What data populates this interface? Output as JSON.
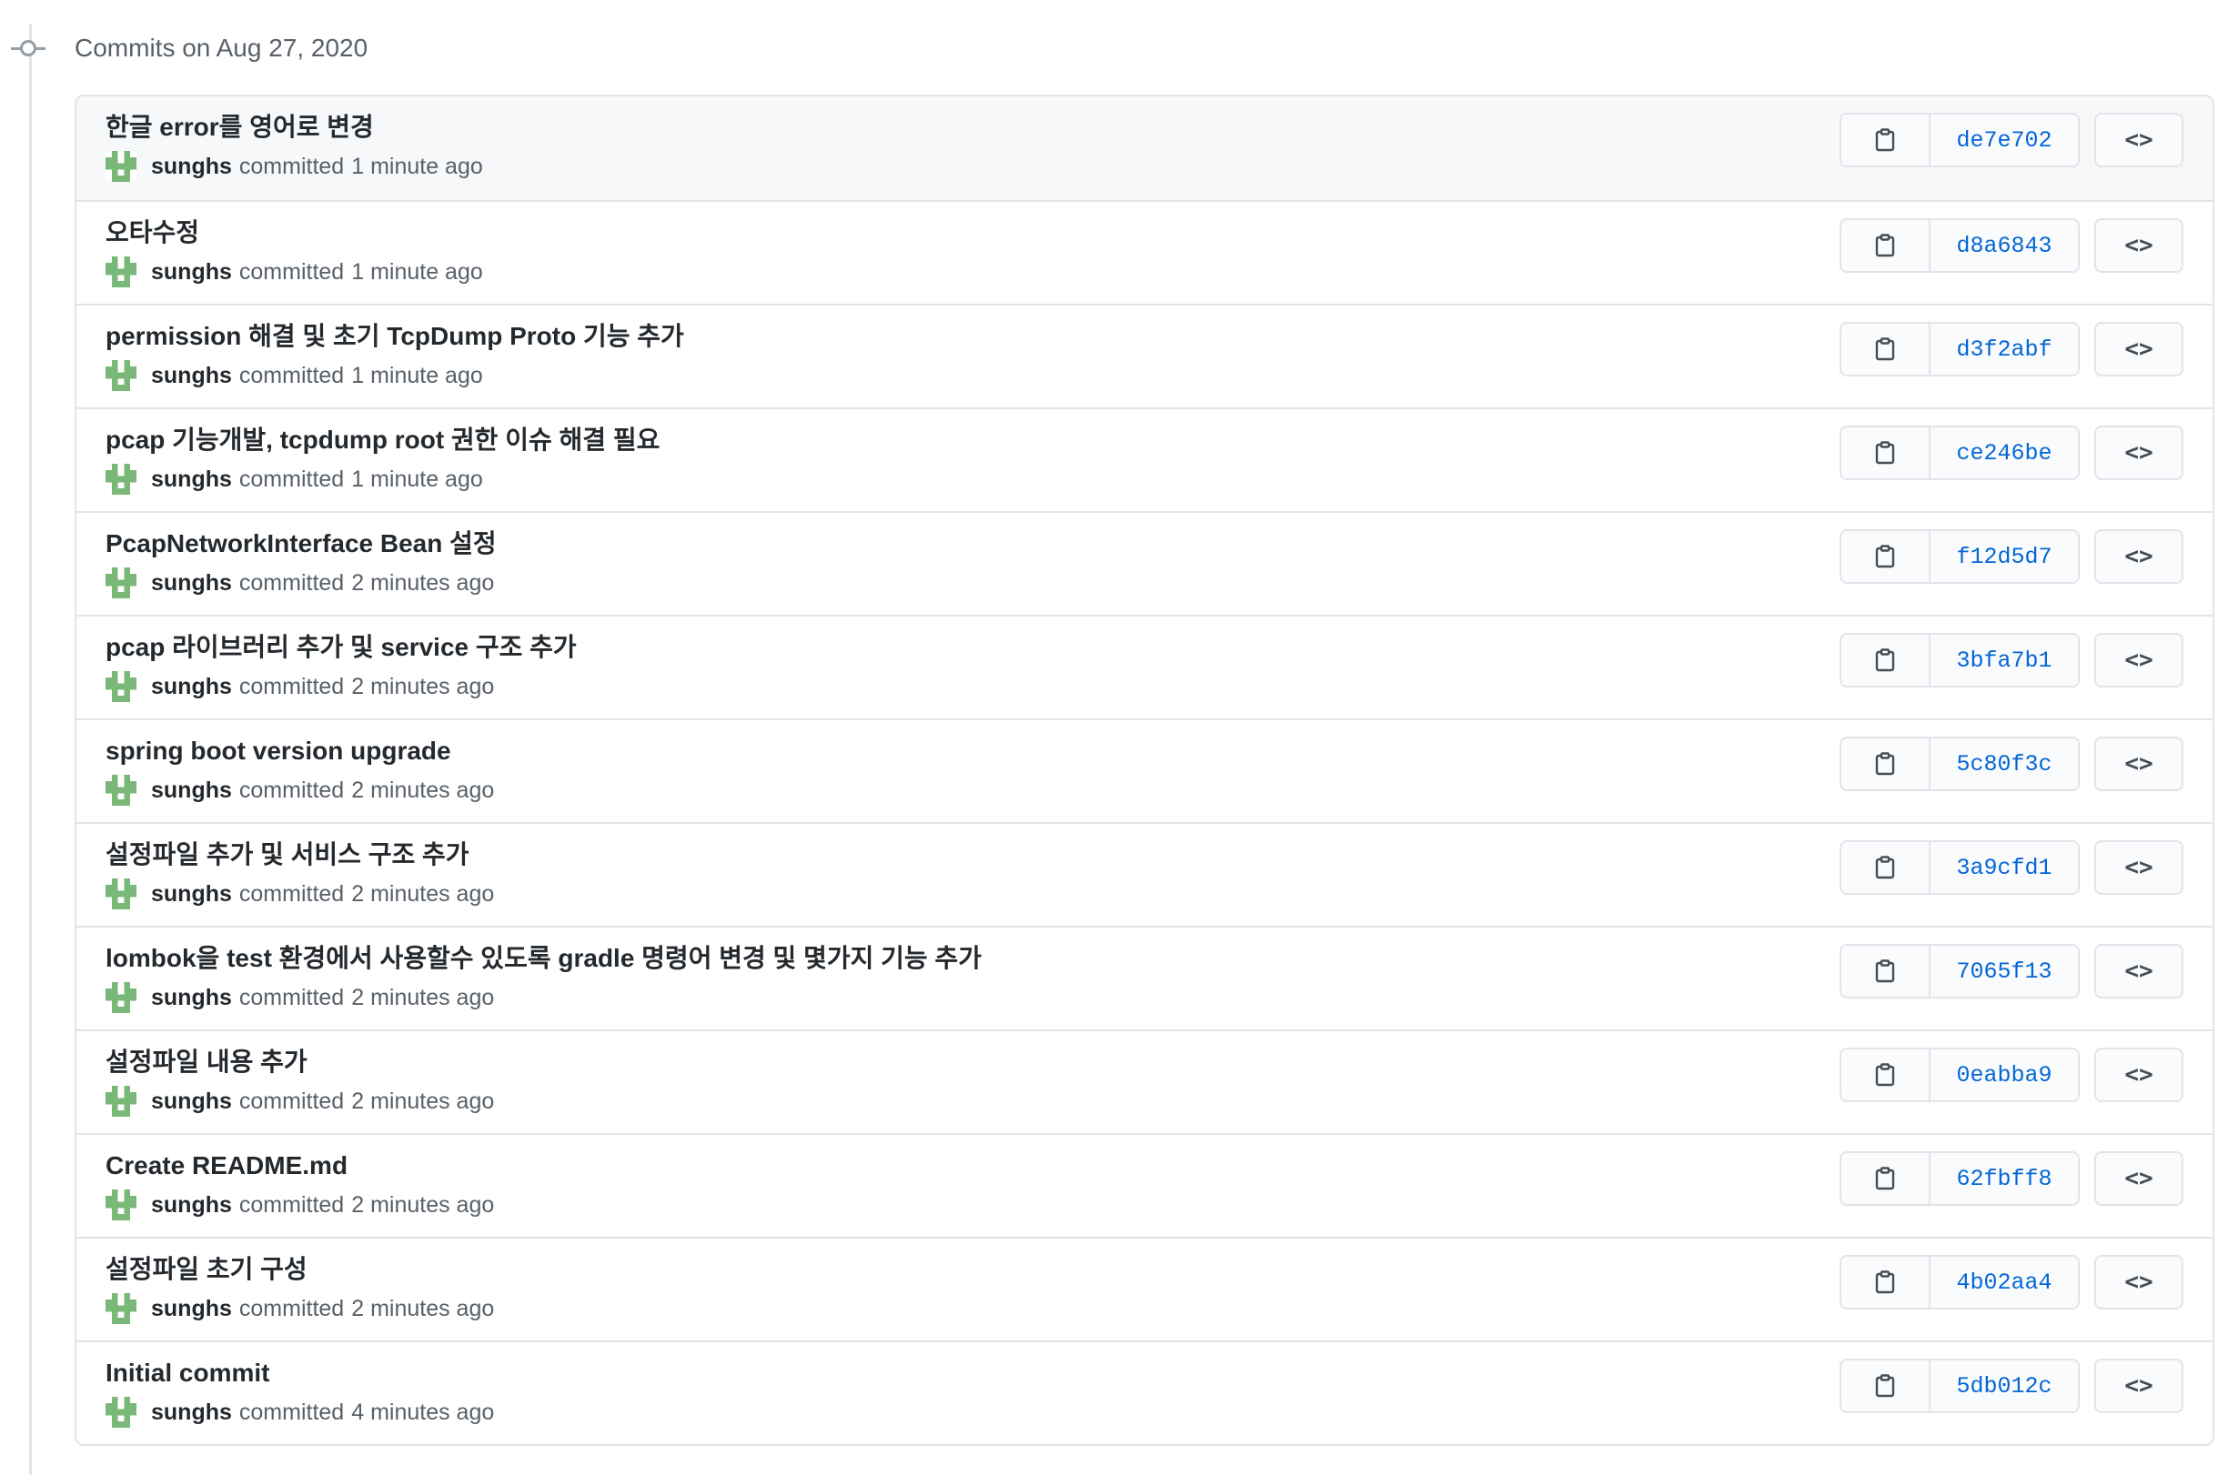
{
  "group": {
    "title": "Commits on Aug 27, 2020"
  },
  "commits": [
    {
      "title": "한글 error를 영어로 변경",
      "author": "sunghs",
      "verb": "committed",
      "time": "1 minute ago",
      "sha": "de7e702",
      "browse": "<>"
    },
    {
      "title": "오타수정",
      "author": "sunghs",
      "verb": "committed",
      "time": "1 minute ago",
      "sha": "d8a6843",
      "browse": "<>"
    },
    {
      "title": "permission 해결 및 초기 TcpDump Proto 기능 추가",
      "author": "sunghs",
      "verb": "committed",
      "time": "1 minute ago",
      "sha": "d3f2abf",
      "browse": "<>"
    },
    {
      "title": "pcap 기능개발, tcpdump root 권한 이슈 해결 필요",
      "author": "sunghs",
      "verb": "committed",
      "time": "1 minute ago",
      "sha": "ce246be",
      "browse": "<>"
    },
    {
      "title": "PcapNetworkInterface Bean 설정",
      "author": "sunghs",
      "verb": "committed",
      "time": "2 minutes ago",
      "sha": "f12d5d7",
      "browse": "<>"
    },
    {
      "title": "pcap 라이브러리 추가 및 service 구조 추가",
      "author": "sunghs",
      "verb": "committed",
      "time": "2 minutes ago",
      "sha": "3bfa7b1",
      "browse": "<>"
    },
    {
      "title": "spring boot version upgrade",
      "author": "sunghs",
      "verb": "committed",
      "time": "2 minutes ago",
      "sha": "5c80f3c",
      "browse": "<>"
    },
    {
      "title": "설정파일 추가 및 서비스 구조 추가",
      "author": "sunghs",
      "verb": "committed",
      "time": "2 minutes ago",
      "sha": "3a9cfd1",
      "browse": "<>"
    },
    {
      "title": "lombok을 test 환경에서 사용할수 있도록 gradle 명령어 변경 및 몇가지 기능 추가",
      "author": "sunghs",
      "verb": "committed",
      "time": "2 minutes ago",
      "sha": "7065f13",
      "browse": "<>"
    },
    {
      "title": "설정파일 내용 추가",
      "author": "sunghs",
      "verb": "committed",
      "time": "2 minutes ago",
      "sha": "0eabba9",
      "browse": "<>"
    },
    {
      "title": "Create README.md",
      "author": "sunghs",
      "verb": "committed",
      "time": "2 minutes ago",
      "sha": "62fbff8",
      "browse": "<>"
    },
    {
      "title": "설정파일 초기 구성",
      "author": "sunghs",
      "verb": "committed",
      "time": "2 minutes ago",
      "sha": "4b02aa4",
      "browse": "<>"
    },
    {
      "title": "Initial commit",
      "author": "sunghs",
      "verb": "committed",
      "time": "4 minutes ago",
      "sha": "5db012c",
      "browse": "<>"
    }
  ],
  "icons": {
    "node": "commit-node-icon",
    "copy": "clipboard-icon",
    "avatar": "identicon-avatar"
  },
  "colors": {
    "link": "#0366d6",
    "border": "#e1e4e8",
    "avatar": "#79b877",
    "muted": "#586069"
  }
}
